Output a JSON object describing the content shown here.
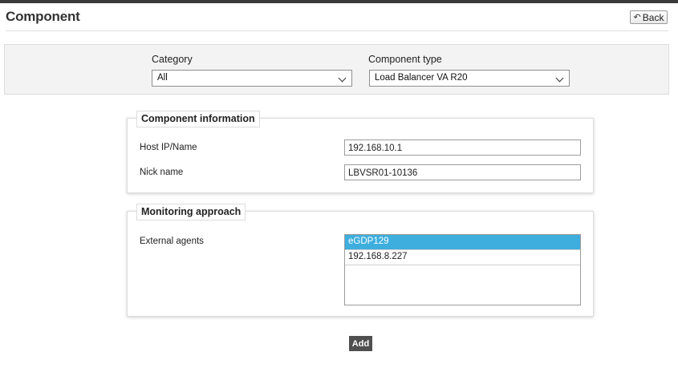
{
  "header": {
    "title": "Component",
    "back_label": "Back"
  },
  "filters": {
    "category": {
      "label": "Category",
      "value": "All"
    },
    "component_type": {
      "label": "Component type",
      "value": "Load Balancer VA R20"
    }
  },
  "component_info": {
    "legend": "Component information",
    "host": {
      "label": "Host IP/Name",
      "value": "192.168.10.1"
    },
    "nick": {
      "label": "Nick name",
      "value": "LBVSR01-10136"
    }
  },
  "monitoring": {
    "legend": "Monitoring approach",
    "agents_label": "External agents",
    "agents": [
      "eGDP129",
      "192.168.8.227"
    ],
    "selected_index": 0
  },
  "actions": {
    "add_label": "Add"
  },
  "colors": {
    "selection": "#3daede",
    "topbar": "#3a3a3a",
    "add_button": "#4f4f4f"
  }
}
